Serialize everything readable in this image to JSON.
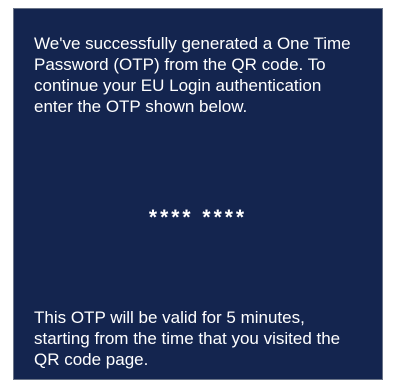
{
  "message": {
    "intro": "We've successfully generated a One Time\nPassword (OTP) from the QR code. To\ncontinue your EU Login authentication\nenter the OTP shown below.",
    "otp_masked": "**** ****",
    "validity": "This OTP will be valid for 5 minutes,\nstarting from the time that you visited the\nQR code page."
  },
  "colors": {
    "background": "#14254f",
    "text": "#ffffff"
  }
}
